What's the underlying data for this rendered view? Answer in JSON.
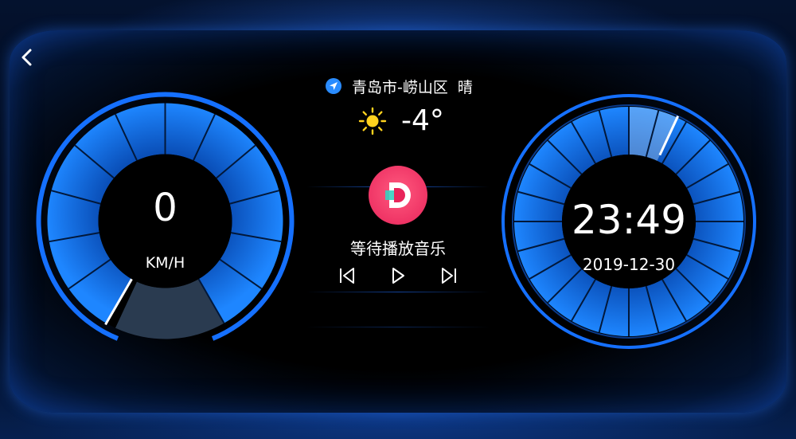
{
  "location": {
    "text": "青岛市-崂山区  晴"
  },
  "weather": {
    "temperature": "-4°",
    "icon": "sun-icon"
  },
  "speedometer": {
    "value": "0",
    "unit": "KM/H",
    "level": 0
  },
  "clock": {
    "time": "23:49",
    "date": "2019-12-30"
  },
  "music": {
    "status": "等待播放音乐",
    "app_icon": "music-app-icon"
  },
  "controls": {
    "prev": "previous-track-icon",
    "play": "play-icon",
    "next": "next-track-icon"
  },
  "colors": {
    "accent": "#1e7dff",
    "ring": "#0a66e8",
    "music_app": "#e8245a",
    "sun": "#ffd21e"
  }
}
